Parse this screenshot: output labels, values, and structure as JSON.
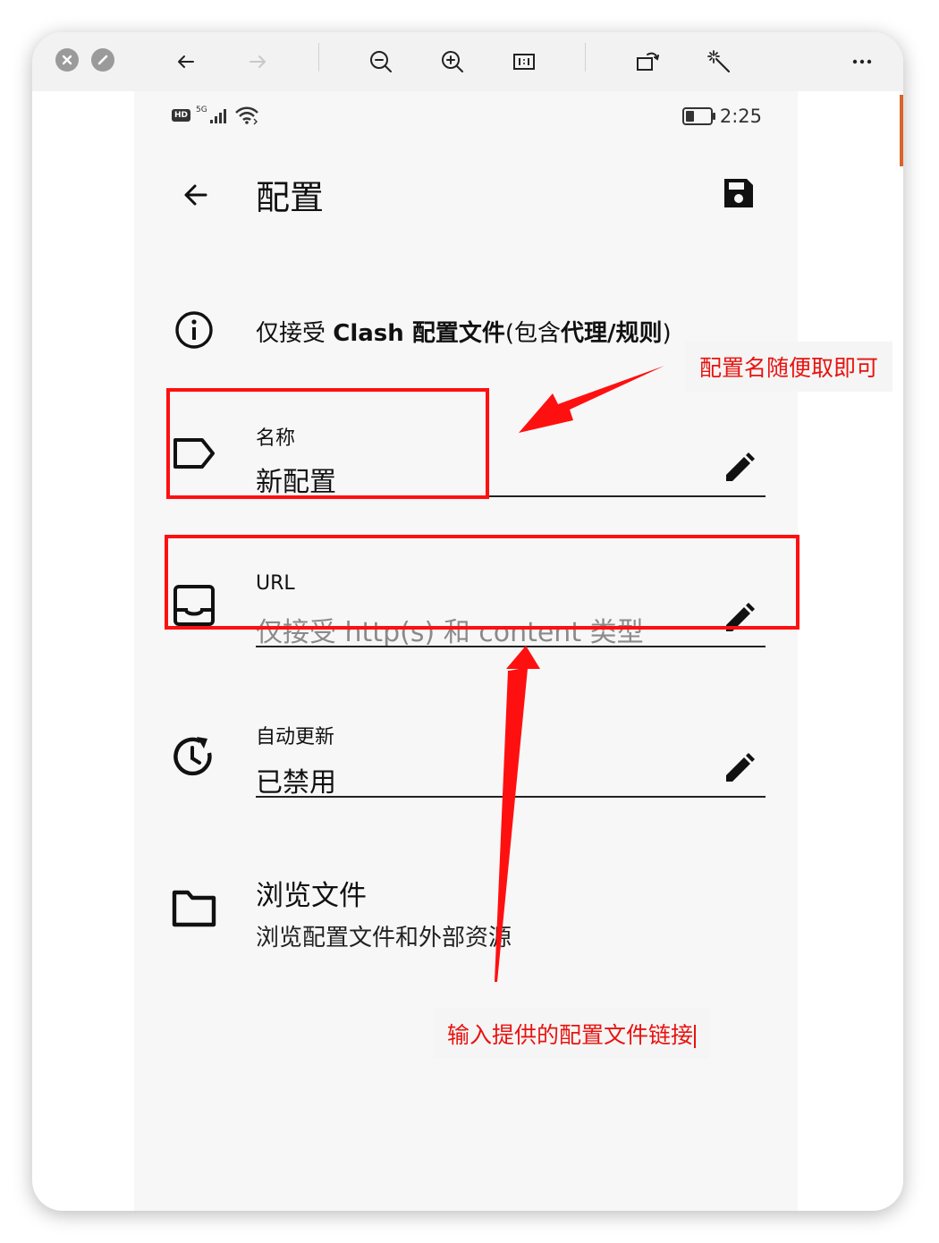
{
  "toolbar": {
    "icons": [
      "close-icon",
      "minimize-icon",
      "back-arrow-icon",
      "forward-arrow-icon",
      "zoom-out-icon",
      "zoom-in-icon",
      "actual-size-icon",
      "rotate-icon",
      "magic-wand-icon",
      "more-icon"
    ]
  },
  "status_bar": {
    "hd": "HD",
    "network": "5G",
    "time": "2:25",
    "battery_level": 0.35
  },
  "app_bar": {
    "title": "配置"
  },
  "info": {
    "prefix": "仅接受 ",
    "bold1": "Clash 配置文件",
    "middle": "(包含",
    "bold2": "代理/规则",
    "suffix": ")"
  },
  "fields": {
    "name": {
      "label": "名称",
      "value": "新配置"
    },
    "url": {
      "label": "URL",
      "placeholder": "仅接受 http(s) 和 content 类型"
    },
    "auto_update": {
      "label": "自动更新",
      "value": "已禁用"
    }
  },
  "browse": {
    "title": "浏览文件",
    "subtitle": "浏览配置文件和外部资源"
  },
  "annotations": {
    "name_hint": "配置名随便取即可",
    "url_hint": "输入提供的配置文件链接",
    "color": "#ff1010"
  },
  "colors": {
    "phone_background": "#f7f7f7",
    "toolbar_background": "#f2f2f2",
    "annotation_text": "#e8130f"
  }
}
